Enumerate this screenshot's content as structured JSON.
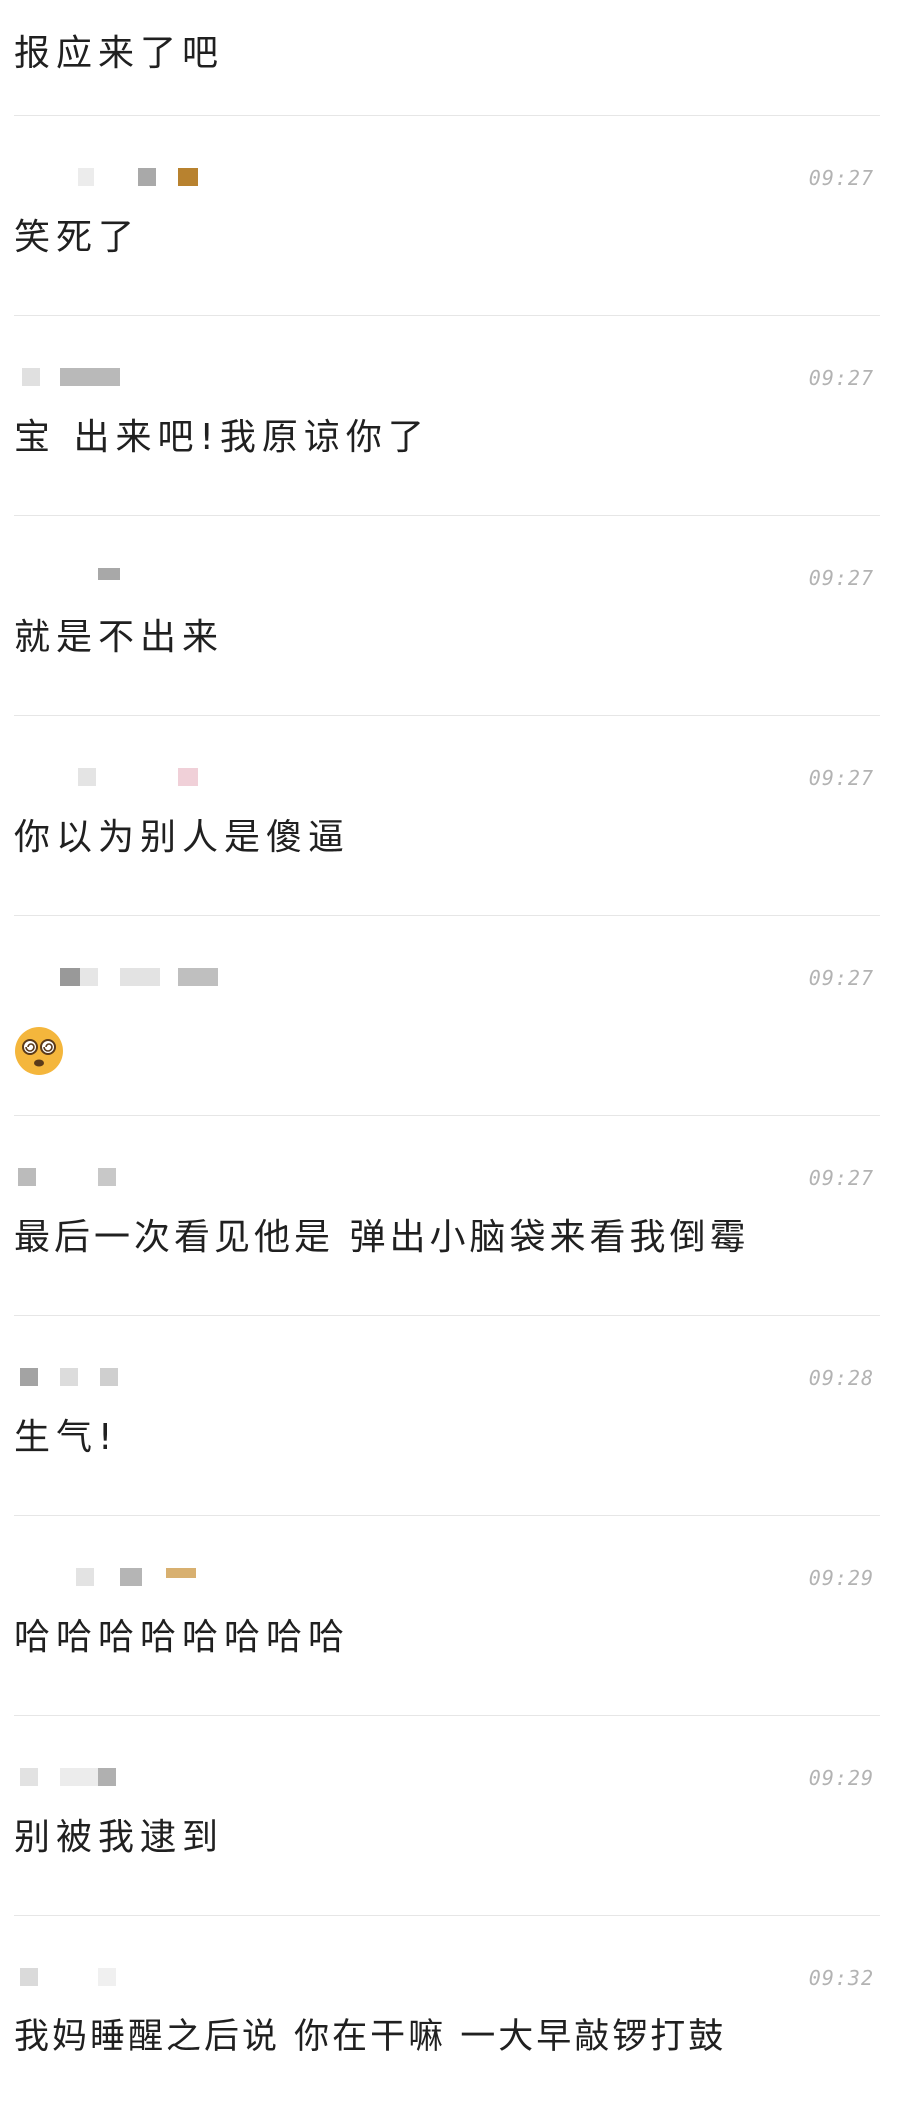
{
  "comments": [
    {
      "time": "",
      "text": "报应来了吧"
    },
    {
      "time": "09:27",
      "text": "笑死了"
    },
    {
      "time": "09:27",
      "text": "宝 出来吧!我原谅你了"
    },
    {
      "time": "09:27",
      "text": "就是不出来"
    },
    {
      "time": "09:27",
      "text": "你以为别人是傻逼"
    },
    {
      "time": "09:27",
      "text": "",
      "emoji": "dizzy-face"
    },
    {
      "time": "09:27",
      "text": "最后一次看见他是 弹出小脑袋来看我倒霉"
    },
    {
      "time": "09:28",
      "text": "生气!"
    },
    {
      "time": "09:29",
      "text": "哈哈哈哈哈哈哈哈"
    },
    {
      "time": "09:29",
      "text": "别被我逮到"
    },
    {
      "time": "09:32",
      "text": "我妈睡醒之后说 你在干嘛 一大早敲锣打鼓"
    }
  ],
  "colors": {
    "timestamp": "#b3b3b3",
    "divider": "#e6e6e6",
    "text": "#202020",
    "emoji": "#f4b63c"
  }
}
